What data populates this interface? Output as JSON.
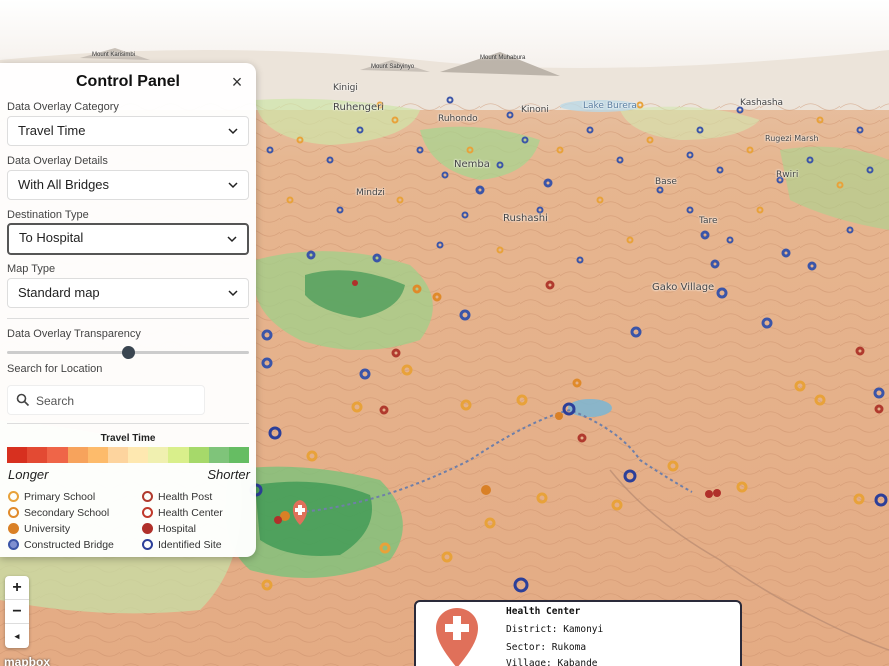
{
  "map": {
    "mountains": [
      "Mount Karisimbi",
      "Mount Sabyinyo",
      "Mount Muhabura"
    ],
    "places": [
      "Kinigi",
      "Ruhengeri",
      "Ruhondo",
      "Kinoni",
      "Lake Burera",
      "Kashasha",
      "Rugezi Marsh",
      "Nemba",
      "Base",
      "Rwiri",
      "Mindzi",
      "Rushashi",
      "Tare",
      "Gako Village"
    ],
    "attribution": "mapbox"
  },
  "control_panel": {
    "title": "Control Panel",
    "close_icon": "close-icon",
    "overlay_category": {
      "label": "Data Overlay Category",
      "value": "Travel Time"
    },
    "overlay_details": {
      "label": "Data Overlay Details",
      "value": "With All Bridges"
    },
    "destination_type": {
      "label": "Destination Type",
      "value": "To Hospital"
    },
    "map_type": {
      "label": "Map Type",
      "value": "Standard map"
    },
    "transparency": {
      "label": "Data Overlay Transparency",
      "value": 0.5
    },
    "search": {
      "label": "Search for Location",
      "placeholder": "Search",
      "icon": "search-icon"
    },
    "legend": {
      "title": "Travel Time",
      "left_label": "Longer",
      "right_label": "Shorter",
      "colors": [
        "#d7301f",
        "#e34a33",
        "#ef6548",
        "#f7a35c",
        "#fdbb6b",
        "#fdd49e",
        "#fee8b0",
        "#f0f0b0",
        "#d9ef8b",
        "#a6d96a",
        "#7fc47a",
        "#66bd63"
      ],
      "items": [
        {
          "label": "Primary School",
          "color": "#e8a23a",
          "style": "ring"
        },
        {
          "label": "Health Post",
          "color": "#b03a2e",
          "style": "ring"
        },
        {
          "label": "Secondary School",
          "color": "#e08a2a",
          "style": "ring"
        },
        {
          "label": "Health Center",
          "color": "#c0392b",
          "style": "ring"
        },
        {
          "label": "University",
          "color": "#d98026",
          "style": "solid"
        },
        {
          "label": "Hospital",
          "color": "#b0302a",
          "style": "solid"
        },
        {
          "label": "Constructed Bridge",
          "color": "#3b55a8",
          "style": "solid-ring"
        },
        {
          "label": "Identified Site",
          "color": "#2c3f99",
          "style": "ring"
        }
      ]
    }
  },
  "zoom": {
    "in": "+",
    "out": "−",
    "compass": "◂"
  },
  "popup": {
    "title": "Health Center",
    "district": "District: Kamonyi",
    "sector": "Sector: Rukoma",
    "village": "Village: Kabande",
    "icon": "health-pin-icon"
  },
  "colors": {
    "pin": "#e0705a",
    "terrain": "#e9b48e",
    "green_zone": "#5db46b"
  }
}
